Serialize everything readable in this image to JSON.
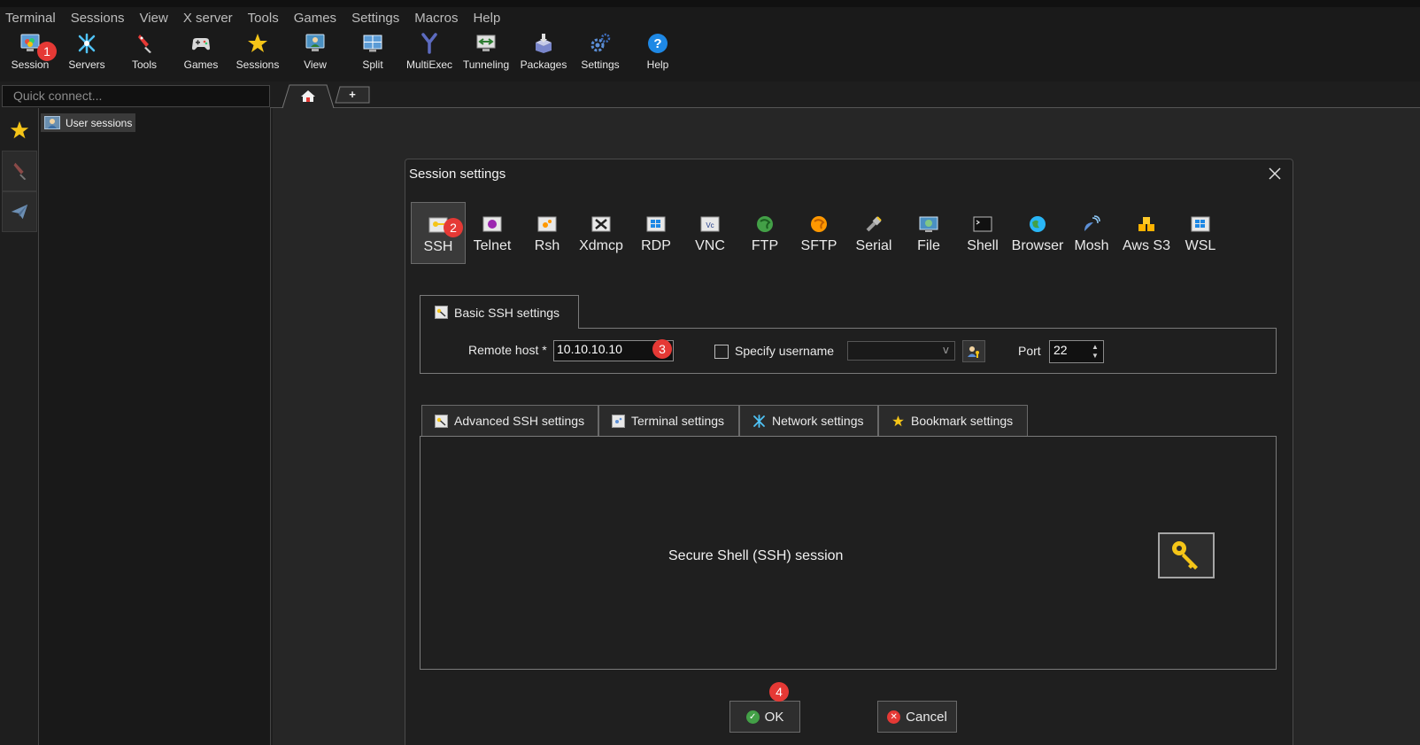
{
  "menu": [
    "Terminal",
    "Sessions",
    "View",
    "X server",
    "Tools",
    "Games",
    "Settings",
    "Macros",
    "Help"
  ],
  "toolbar": {
    "session": "Session",
    "servers": "Servers",
    "tools": "Tools",
    "games": "Games",
    "sessions": "Sessions",
    "view": "View",
    "split": "Split",
    "multiexec": "MultiExec",
    "tunneling": "Tunneling",
    "packages": "Packages",
    "settings": "Settings",
    "help": "Help"
  },
  "quick_connect": {
    "placeholder": "Quick connect..."
  },
  "tabs": {
    "new_tab_label": "+"
  },
  "tree": {
    "user_sessions": "User sessions"
  },
  "dialog": {
    "title": "Session settings",
    "types": {
      "ssh": "SSH",
      "telnet": "Telnet",
      "rsh": "Rsh",
      "xdmcp": "Xdmcp",
      "rdp": "RDP",
      "vnc": "VNC",
      "ftp": "FTP",
      "sftp": "SFTP",
      "serial": "Serial",
      "file": "File",
      "shell": "Shell",
      "browser": "Browser",
      "mosh": "Mosh",
      "aws_s3": "Aws S3",
      "wsl": "WSL"
    },
    "selected_type": "SSH",
    "basic_tab": "Basic SSH settings",
    "remote_host_label": "Remote host *",
    "remote_host_value": "10.10.10.10",
    "specify_username_label": "Specify username",
    "specify_username_checked": false,
    "port_label": "Port",
    "port_value": "22",
    "adv_tabs": {
      "advanced": "Advanced SSH settings",
      "terminal": "Terminal settings",
      "network": "Network settings",
      "bookmark": "Bookmark settings"
    },
    "description": "Secure Shell (SSH) session",
    "ok": "OK",
    "cancel": "Cancel"
  },
  "annotations": {
    "step1": "1",
    "step2": "2",
    "step3": "3",
    "step4": "4"
  },
  "colors": {
    "badge": "#e53935",
    "background": "#1e1e1e",
    "dialog": "#1f1f1f"
  }
}
